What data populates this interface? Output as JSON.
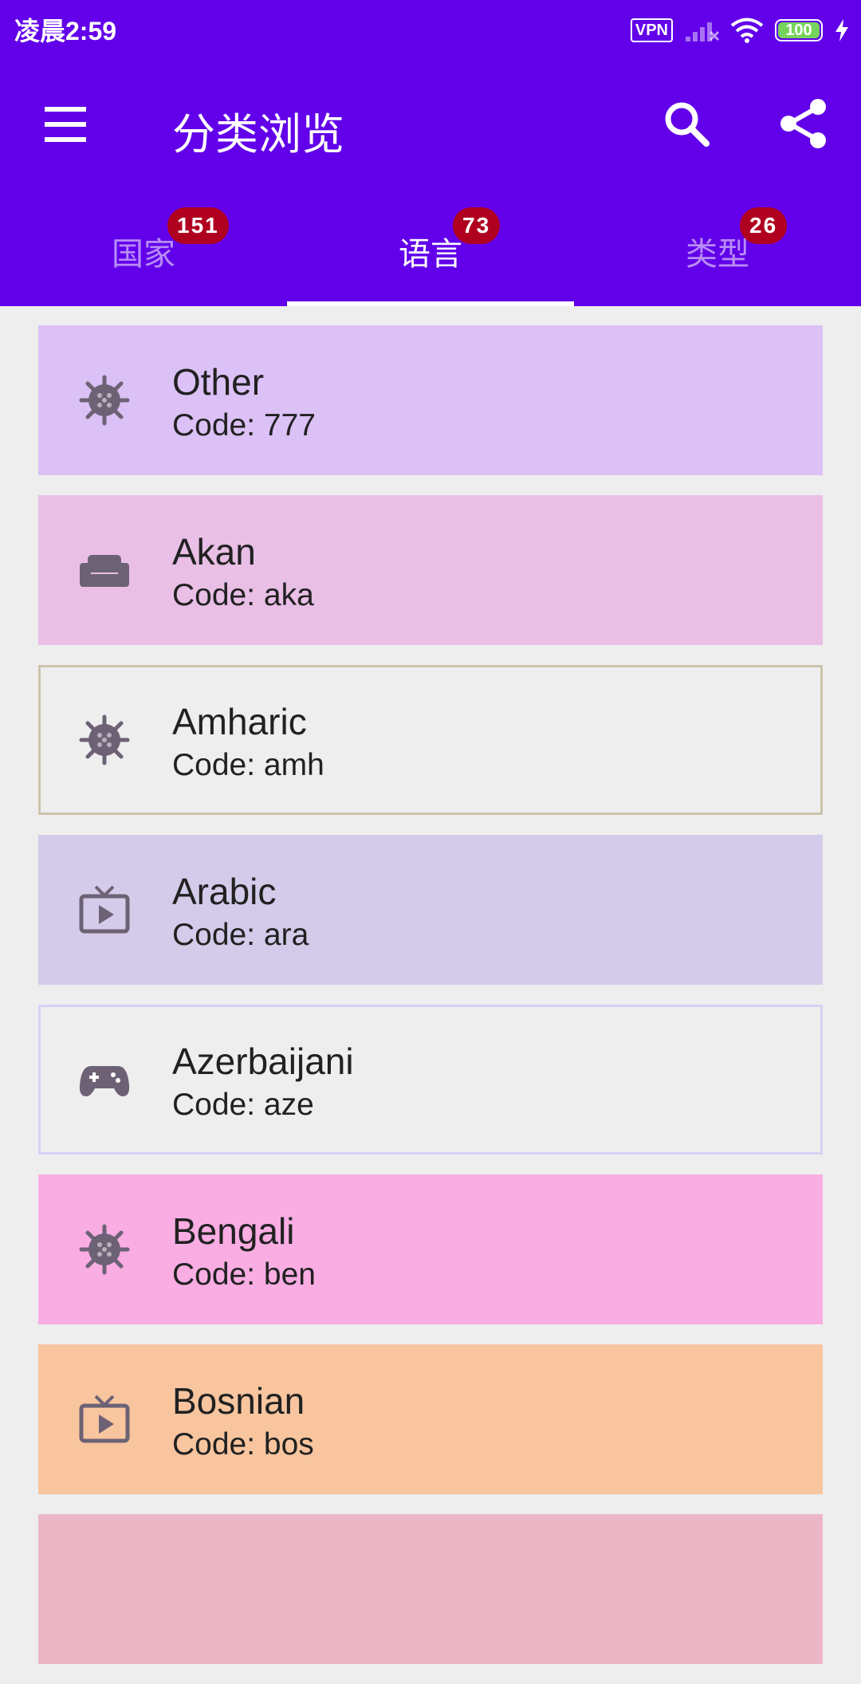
{
  "status_bar": {
    "time": "凌晨2:59",
    "vpn": "VPN",
    "battery": "100"
  },
  "toolbar": {
    "title": "分类浏览",
    "menu_icon": "menu-icon",
    "search_icon": "search-icon",
    "share_icon": "share-icon"
  },
  "tabs": [
    {
      "label": "国家",
      "badge": "151",
      "active": false
    },
    {
      "label": "语言",
      "badge": "73",
      "active": true
    },
    {
      "label": "类型",
      "badge": "26",
      "active": false
    }
  ],
  "colors": {
    "primary": "#6200ea",
    "badge": "#b00020",
    "icon": "#6d6275"
  },
  "items": [
    {
      "name": "Other",
      "code": "Code: 777",
      "icon": "virus-icon",
      "bg": "#dbc1f5",
      "outlined": false
    },
    {
      "name": "Akan",
      "code": "Code: aka",
      "icon": "sofa-icon",
      "bg": "#e9bfe6",
      "outlined": false
    },
    {
      "name": "Amharic",
      "code": "Code: amh",
      "icon": "virus-icon",
      "bg": "#eeeeee",
      "border": "#cbc4ad",
      "outlined": true
    },
    {
      "name": "Arabic",
      "code": "Code: ara",
      "icon": "live-tv-icon",
      "bg": "#d3cbe9",
      "outlined": false
    },
    {
      "name": "Azerbaijani",
      "code": "Code: aze",
      "icon": "gamepad-icon",
      "bg": "#eeeeee",
      "border": "#d3d3f5",
      "outlined": true
    },
    {
      "name": "Bengali",
      "code": "Code: ben",
      "icon": "virus-icon",
      "bg": "#f9ade3",
      "outlined": false
    },
    {
      "name": "Bosnian",
      "code": "Code: bos",
      "icon": "live-tv-icon",
      "bg": "#f8c59f",
      "outlined": false
    },
    {
      "name": "",
      "code": "",
      "icon": "",
      "bg": "#ebb7c6",
      "outlined": false
    }
  ]
}
